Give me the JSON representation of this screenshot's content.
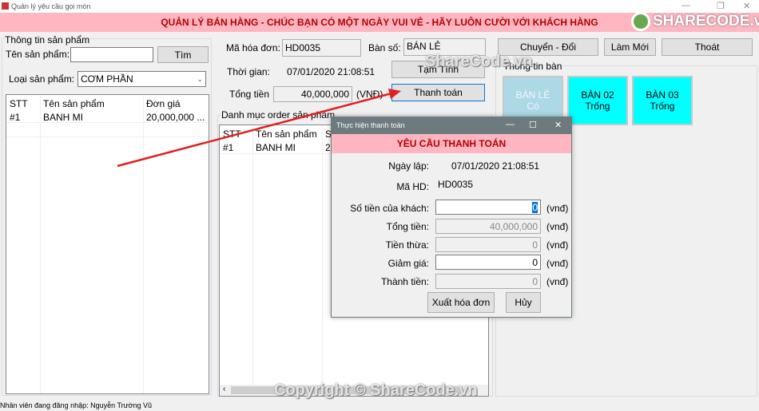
{
  "window": {
    "title": "Quản lý yêu cầu gọi món",
    "min": "—",
    "restore": "❐",
    "close": "✕"
  },
  "banner": "QUẢN LÝ BÁN HÀNG - CHÚC BẠN CÓ MỘT NGÀY VUI VẺ - HÃY LUÔN CƯỜI VỚI KHÁCH HÀNG",
  "logo": "SHARECODE.vn",
  "product": {
    "group": "Thông tin sản phẩm",
    "name_label": "Tên sản phẩm:",
    "name_value": "",
    "search": "Tìm",
    "type_label": "Loại sản phẩm:",
    "type_value": "CƠM PHẦN",
    "columns": [
      "STT",
      "Tên sản phẩm",
      "Đơn giá"
    ],
    "rows": [
      [
        "#1",
        "BANH MI",
        "20,000,000 ..."
      ]
    ]
  },
  "invoice": {
    "code_label": "Mã hóa đơn:",
    "code": "HD0035",
    "table_label": "Bàn số:",
    "table": "BÁN LẺ",
    "time_label": "Thời gian:",
    "time": "07/01/2020 21:08:51",
    "total_label": "Tổng tiền",
    "total": "40,000,000",
    "unit": "(VNĐ)",
    "temp": "Tạm Tính",
    "pay": "Thanh toán"
  },
  "order": {
    "group": "Danh mục order sản phẩm",
    "columns": [
      "STT",
      "Tên sản phẩm",
      "S"
    ],
    "rows": [
      [
        "#1",
        "BANH MI",
        "2"
      ]
    ],
    "scroll_left": "‹"
  },
  "actions": {
    "switch": "Chuyển - Đổi",
    "refresh": "Làm Mới",
    "exit": "Thoát"
  },
  "tables": {
    "group": "Thông tin bàn",
    "items": [
      {
        "name": "BÁN LẺ",
        "status": "Có",
        "color": "#add8e6"
      },
      {
        "name": "BÀN 02",
        "status": "Trống",
        "color": "#00ffff"
      },
      {
        "name": "BÀN 03",
        "status": "Trống",
        "color": "#00ffff"
      }
    ]
  },
  "dialog": {
    "title": "Thực hiện thanh toán",
    "header": "YÊU CẦU THANH TOÁN",
    "date_label": "Ngày lập:",
    "date": "07/01/2020 21:08:51",
    "code_label": "Mã HD:",
    "code": "HD0035",
    "paid_label": "Số tiền của khách:",
    "paid": "0",
    "total_label": "Tổng tiền:",
    "total": "40,000,000",
    "change_label": "Tiền thừa:",
    "change": "0",
    "discount_label": "Giảm giá:",
    "discount": "0",
    "final_label": "Thành tiền:",
    "final": "0",
    "unit": "(vnđ)",
    "export": "Xuất hóa đơn",
    "cancel": "Hủy"
  },
  "status": "Nhân viên đang đăng nhập: Nguyễn Trường Vũ",
  "watermark": {
    "top": "ShareCode.vn",
    "bottom": "Copyright © ShareCode.vn"
  },
  "colors": {
    "banner": "#ffb6c1",
    "banner_text": "#b00000",
    "arrow": "#e02020"
  }
}
